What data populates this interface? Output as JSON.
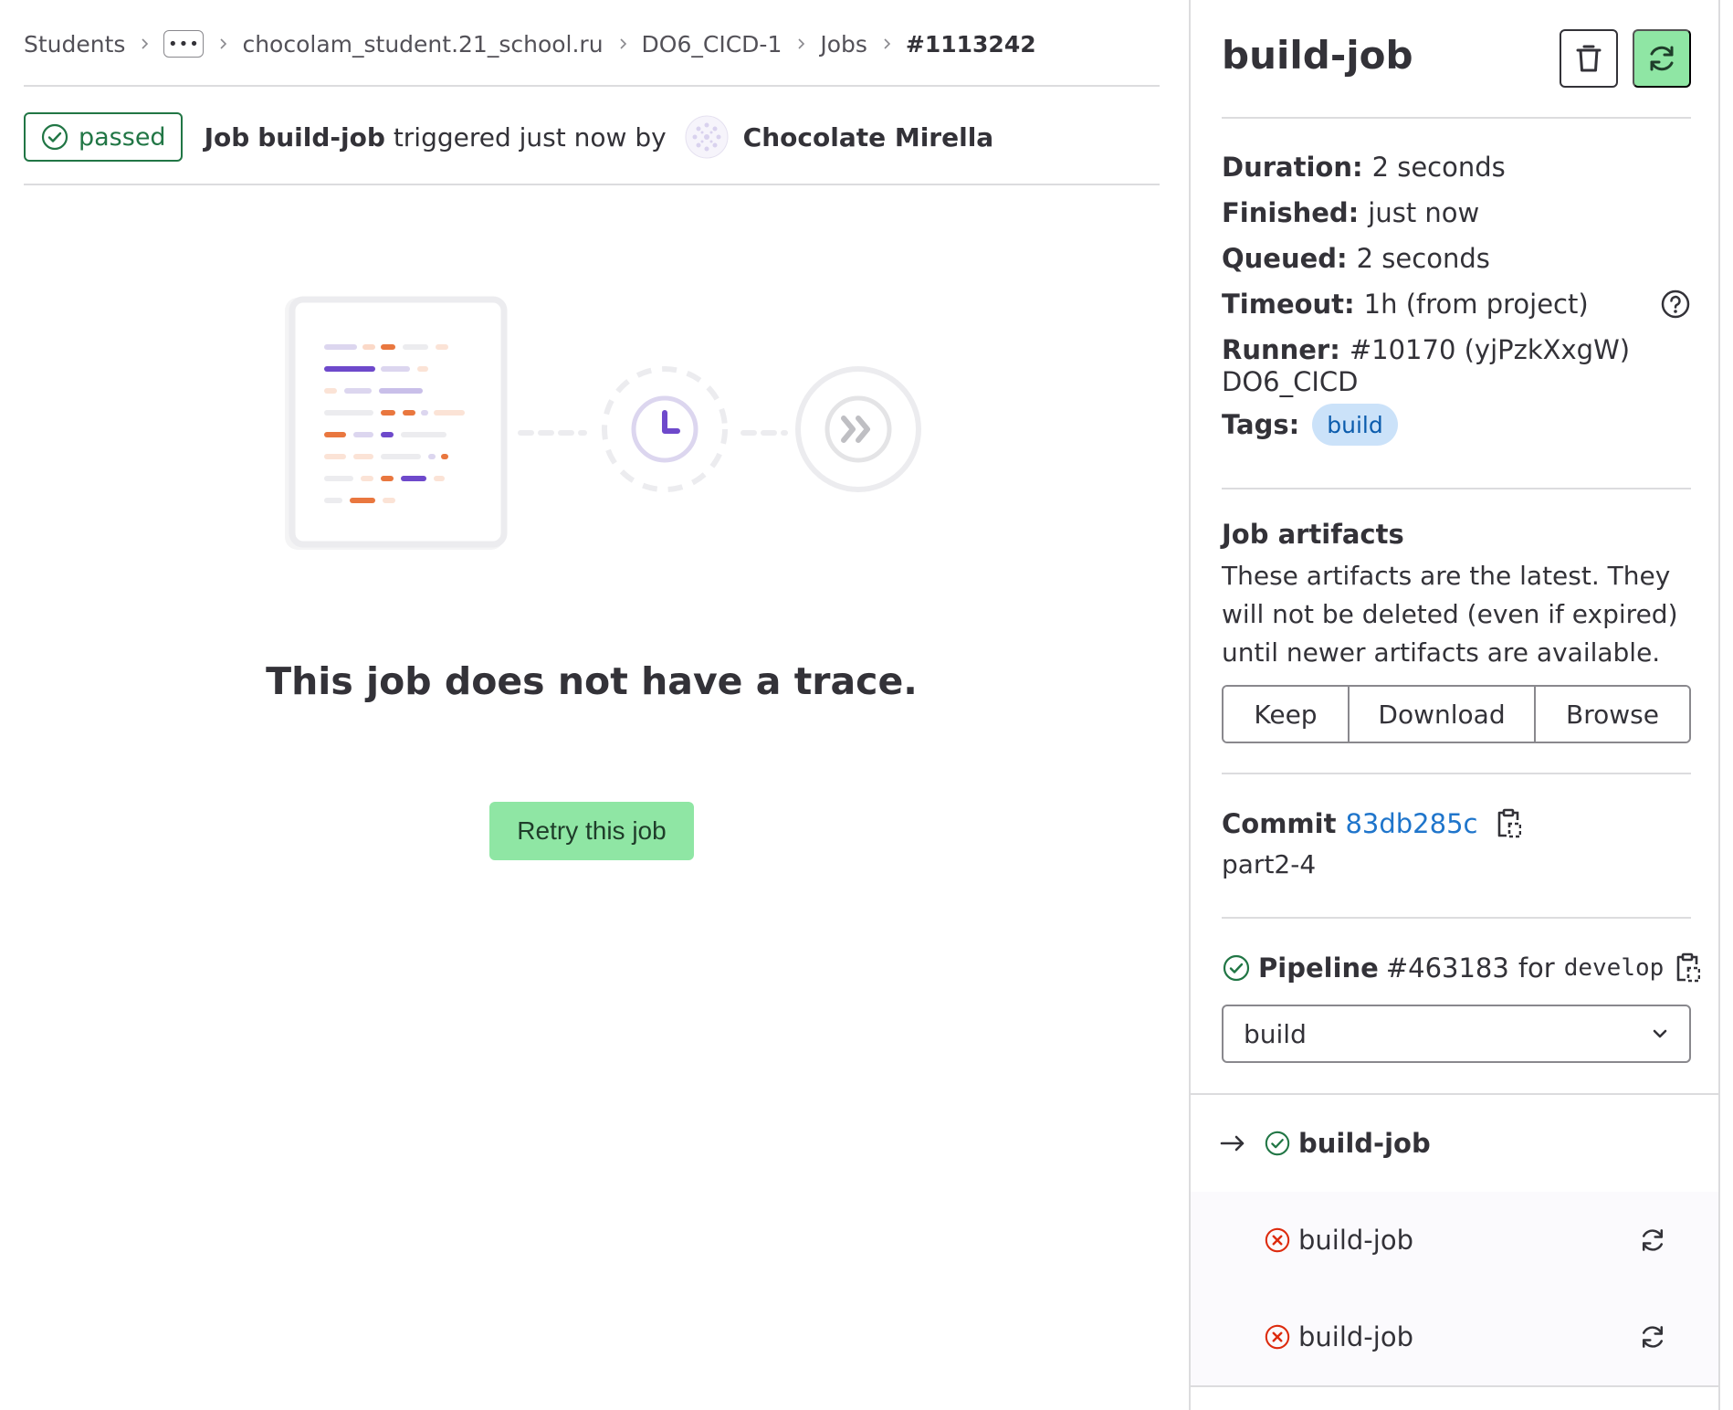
{
  "breadcrumb": {
    "items": [
      "Students",
      "chocolam_student.21_school.ru",
      "DO6_CICD-1",
      "Jobs"
    ],
    "ellipsis": "•••",
    "current": "#1113242"
  },
  "job_header": {
    "status": "passed",
    "prefix": "Job",
    "job_name": "build-job",
    "triggered_text": "triggered just now by",
    "author": "Chocolate Mirella"
  },
  "empty_state": {
    "title": "This job does not have a trace.",
    "retry_label": "Retry this job"
  },
  "sidebar": {
    "title": "build-job",
    "details": {
      "duration_label": "Duration:",
      "duration": "2 seconds",
      "finished_label": "Finished:",
      "finished": "just now",
      "queued_label": "Queued:",
      "queued": "2 seconds",
      "timeout_label": "Timeout:",
      "timeout": "1h (from project)",
      "runner_label": "Runner:",
      "runner": "#10170 (yjPzkXxgW)",
      "runner_desc": "DO6_CICD",
      "tags_label": "Tags:",
      "tag": "build"
    },
    "artifacts": {
      "title": "Job artifacts",
      "description": "These artifacts are the latest. They will not be deleted (even if expired) until newer artifacts are available.",
      "keep": "Keep",
      "download": "Download",
      "browse": "Browse"
    },
    "commit": {
      "label": "Commit",
      "sha": "83db285c",
      "message": "part2-4"
    },
    "pipeline": {
      "label": "Pipeline",
      "id": "#463183",
      "for_text": "for",
      "ref": "develop"
    },
    "stage_select": {
      "selected": "build"
    },
    "jobs": [
      {
        "name": "build-job",
        "status": "success",
        "current": true
      },
      {
        "name": "build-job",
        "status": "failed",
        "current": false
      },
      {
        "name": "build-job",
        "status": "failed",
        "current": false
      }
    ],
    "colors": {
      "success": "#217645",
      "failed": "#dd2b0e",
      "link": "#1f75cb",
      "retry_bg": "#8fe6a4"
    }
  }
}
